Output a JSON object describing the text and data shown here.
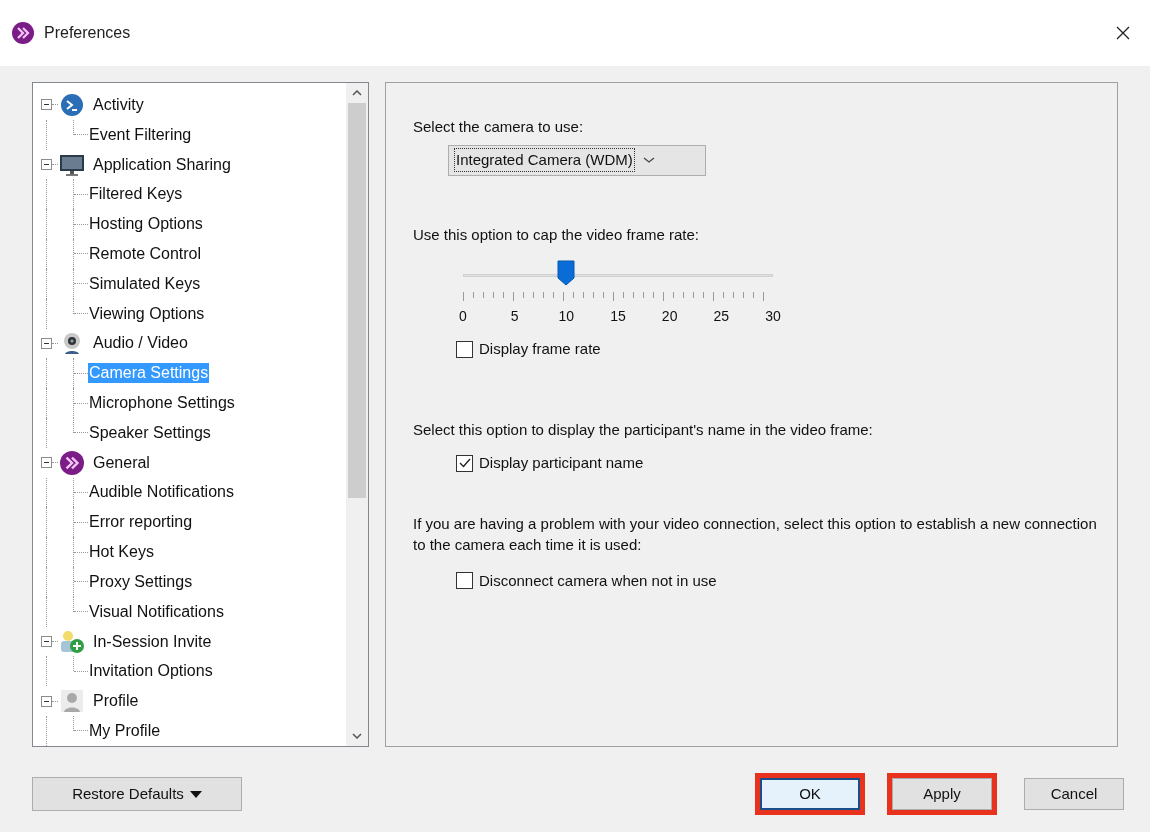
{
  "window": {
    "title": "Preferences"
  },
  "tree": [
    {
      "label": "Activity",
      "kind": "activity",
      "expanded": true,
      "selected": false,
      "children": [
        {
          "label": "Event Filtering",
          "selected": false
        }
      ]
    },
    {
      "label": "Application Sharing",
      "kind": "monitor",
      "expanded": true,
      "selected": false,
      "children": [
        {
          "label": "Filtered Keys",
          "selected": false
        },
        {
          "label": "Hosting Options",
          "selected": false
        },
        {
          "label": "Remote Control",
          "selected": false
        },
        {
          "label": "Simulated Keys",
          "selected": false
        },
        {
          "label": "Viewing Options",
          "selected": false
        }
      ]
    },
    {
      "label": "Audio / Video",
      "kind": "webcam",
      "expanded": true,
      "selected": false,
      "children": [
        {
          "label": "Camera Settings",
          "selected": true
        },
        {
          "label": "Microphone Settings",
          "selected": false
        },
        {
          "label": "Speaker Settings",
          "selected": false
        }
      ]
    },
    {
      "label": "General",
      "kind": "logo",
      "expanded": true,
      "selected": false,
      "children": [
        {
          "label": "Audible Notifications",
          "selected": false
        },
        {
          "label": "Error reporting",
          "selected": false
        },
        {
          "label": "Hot Keys",
          "selected": false
        },
        {
          "label": "Proxy Settings",
          "selected": false
        },
        {
          "label": "Visual Notifications",
          "selected": false
        }
      ]
    },
    {
      "label": "In-Session Invite",
      "kind": "invite",
      "expanded": true,
      "selected": false,
      "children": [
        {
          "label": "Invitation Options",
          "selected": false
        }
      ]
    },
    {
      "label": "Profile",
      "kind": "profile",
      "expanded": true,
      "selected": false,
      "children": [
        {
          "label": "My Profile",
          "selected": false
        }
      ]
    }
  ],
  "camera": {
    "label": "Select the camera to use:",
    "value": "Integrated Camera (WDM)"
  },
  "frame_rate": {
    "label": "Use this option to cap the video frame rate:",
    "level": 0.333,
    "tick_labels": [
      "0",
      "5",
      "10",
      "15",
      "20",
      "25",
      "30"
    ],
    "checkbox": {
      "label": "Display frame rate",
      "checked": false
    }
  },
  "participant": {
    "label": "Select this option to display the participant's name in the video frame:",
    "checkbox": {
      "label": "Display participant name",
      "checked": true
    }
  },
  "connection": {
    "label": "If you are having a problem with your video connection, select this option to establish a new connection to the camera each time it is used:",
    "checkbox": {
      "label": "Disconnect camera when not in use",
      "checked": false
    }
  },
  "restore_button": {
    "label": "Restore Defaults"
  },
  "buttons": [
    {
      "label": "OK",
      "highlighted": true,
      "default": true
    },
    {
      "label": "Apply",
      "highlighted": true,
      "default": false
    },
    {
      "label": "Cancel",
      "highlighted": false,
      "default": false
    }
  ]
}
